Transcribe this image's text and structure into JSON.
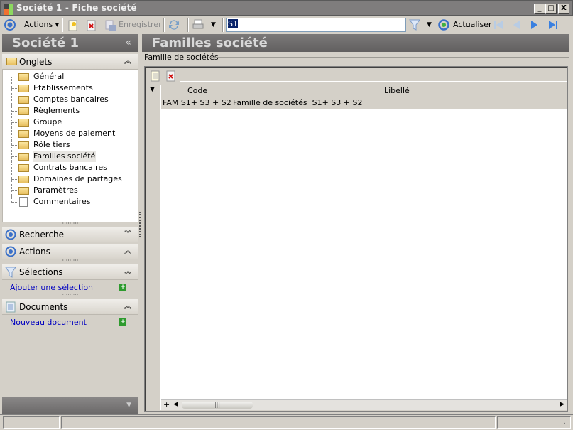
{
  "window": {
    "title": "Société 1 - Fiche société",
    "minimize": "_",
    "maximize": "□",
    "close": "X"
  },
  "toolbar": {
    "actions": "Actions",
    "save": "Enregistrer",
    "search_value": "S1",
    "refresh": "Actualiser"
  },
  "left": {
    "title": "Société 1",
    "collapse": "«",
    "onglets": {
      "label": "Onglets",
      "items": [
        "Général",
        "Etablissements",
        "Comptes bancaires",
        "Règlements",
        "Groupe",
        "Moyens de paiement",
        "Rôle tiers",
        "Familles société",
        "Contrats bancaires",
        "Domaines de partages",
        "Paramètres",
        "Commentaires"
      ],
      "selected": "Familles société"
    },
    "recherche": "Recherche",
    "actions": "Actions",
    "selections": {
      "label": "Sélections",
      "link": "Ajouter une sélection"
    },
    "documents": {
      "label": "Documents",
      "link": "Nouveau document"
    }
  },
  "main": {
    "title": "Familles société",
    "group": "Famille de sociétés",
    "grid": {
      "columns": [
        "Code",
        "Libellé"
      ],
      "rows": [
        {
          "code": "FAM S1+ S3 + S2",
          "libelle": "Famille de sociétés  S1+ S3 + S2"
        }
      ],
      "add": "+",
      "scroll_grip": "|||"
    }
  }
}
